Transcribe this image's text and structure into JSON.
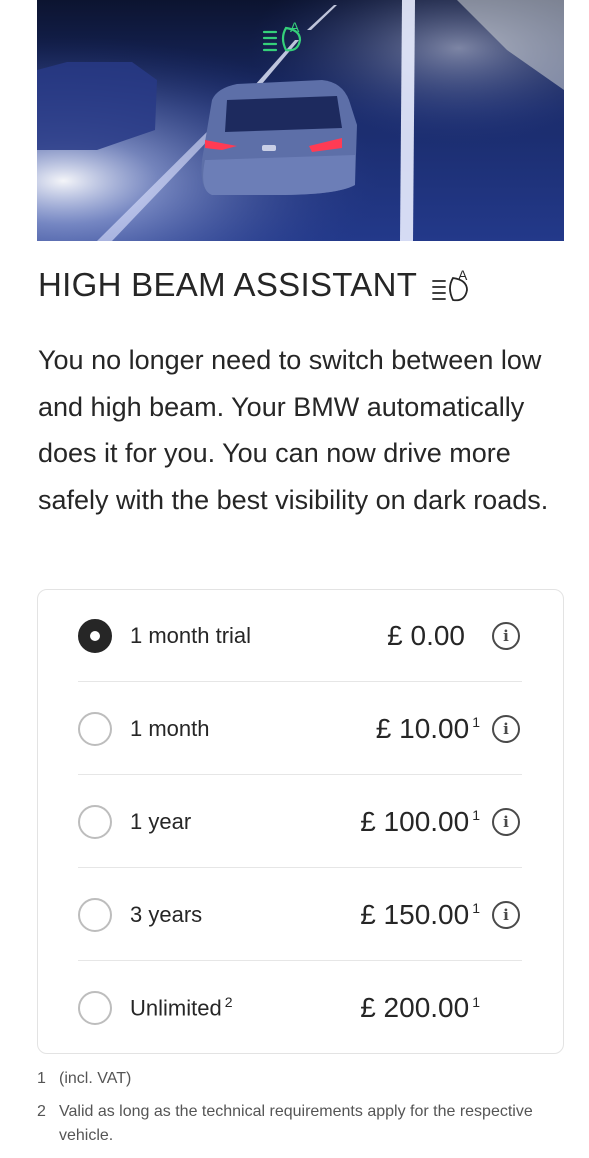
{
  "hero": {
    "icon": "high-beam-assistant-icon",
    "icon_color": "#35d07a"
  },
  "feature": {
    "title": "HIGH BEAM ASSISTANT",
    "title_icon": "high-beam-assistant-icon",
    "description": "You no longer need to switch between low and high beam. Your BMW automatically does it for you. You can now drive more safely with the best visibility on dark roads."
  },
  "options": [
    {
      "label": "1 month trial",
      "label_sup": "",
      "price": "£ 0.00",
      "price_sup": "",
      "selected": true,
      "info": true
    },
    {
      "label": "1 month",
      "label_sup": "",
      "price": "£ 10.00",
      "price_sup": "1",
      "selected": false,
      "info": true
    },
    {
      "label": "1 year",
      "label_sup": "",
      "price": "£ 100.00",
      "price_sup": "1",
      "selected": false,
      "info": true
    },
    {
      "label": "3 years",
      "label_sup": "",
      "price": "£ 150.00",
      "price_sup": "1",
      "selected": false,
      "info": true
    },
    {
      "label": "Unlimited",
      "label_sup": "2",
      "price": "£ 200.00",
      "price_sup": "1",
      "selected": false,
      "info": false
    }
  ],
  "footnotes": [
    {
      "num": "1",
      "text": "(incl. VAT)"
    },
    {
      "num": "2",
      "text": "Valid as long as the technical requirements apply for the respective vehicle."
    }
  ],
  "info_glyph": "i"
}
